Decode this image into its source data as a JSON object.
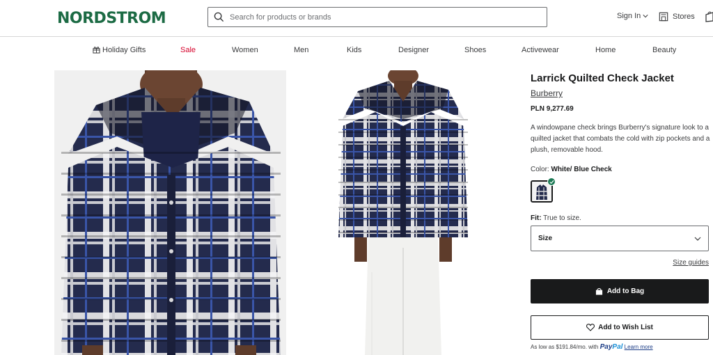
{
  "header": {
    "logo": "NORDSTROM",
    "search_placeholder": "Search for products or brands",
    "sign_in": "Sign In",
    "stores": "Stores"
  },
  "nav": {
    "items": [
      "Holiday Gifts",
      "Sale",
      "Women",
      "Men",
      "Kids",
      "Designer",
      "Shoes",
      "Activewear",
      "Home",
      "Beauty"
    ]
  },
  "product": {
    "title": "Larrick Quilted Check Jacket",
    "brand": "Burberry",
    "price": "PLN 9,277.69",
    "description": "A windowpane check brings Burberry's signature look to a quilted jacket that combats the cold with zip pockets and a plush, removable hood.",
    "color_label": "Color:",
    "color_value": "White/ Blue Check",
    "fit_label": "Fit:",
    "fit_value": "True to size.",
    "size_label": "Size",
    "size_guides": "Size guides",
    "add_to_bag": "Add to Bag",
    "add_to_wish": "Add to Wish List",
    "paypal_prefix": "As low as $191.84/mo. with",
    "paypal_brand_a": "Pay",
    "paypal_brand_b": "Pal",
    "learn_more": "Learn more"
  },
  "colors": {
    "brand_green": "#1c6b44",
    "sale_red": "#d6002a",
    "jacket_navy": "#232a4a",
    "check_green": "#1c7a55"
  },
  "icons": [
    "search-icon",
    "chevron-down-icon",
    "store-icon",
    "bag-icon",
    "gift-icon",
    "shopping-bag-icon",
    "heart-icon",
    "checkmark-icon"
  ]
}
